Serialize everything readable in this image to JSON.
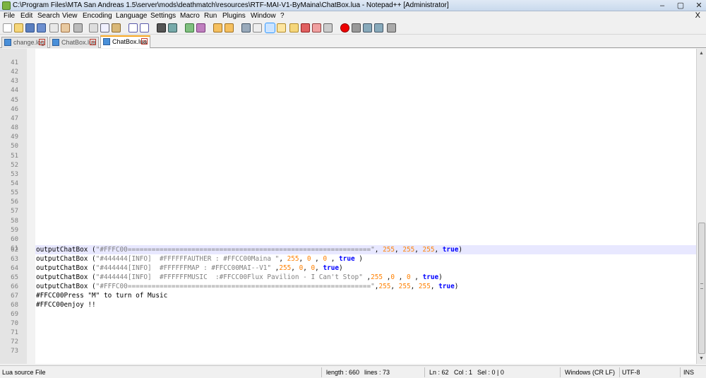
{
  "window": {
    "title": "C:\\Program Files\\MTA San Andreas 1.5\\server\\mods\\deathmatch\\resources\\RTF-MAI-V1-ByMaina\\ChatBox.lua - Notepad++ [Administrator]",
    "controls": [
      "–",
      "▢",
      "✕"
    ]
  },
  "menu": {
    "items": [
      "File",
      "Edit",
      "Search",
      "View",
      "Encoding",
      "Language",
      "Settings",
      "Macro",
      "Run",
      "Plugins",
      "Window",
      "?"
    ],
    "close_label": "X"
  },
  "tabs": [
    {
      "label": "change.log",
      "active": false
    },
    {
      "label": "ChatBox.lua",
      "active": false
    },
    {
      "label": "ChatBox.lua",
      "active": true
    }
  ],
  "editor": {
    "empty_lines": [
      "41",
      "42",
      "43",
      "44",
      "45",
      "46",
      "47",
      "48",
      "49",
      "50",
      "51",
      "52",
      "53",
      "54",
      "55",
      "56",
      "57",
      "58",
      "59",
      "60",
      "61"
    ],
    "code_lines": [
      {
        "num": "62",
        "fn": "outputChatBox",
        "open": " (",
        "str": "\"#FFFC00=============================================================\"",
        "rest": [
          ", ",
          "255",
          ", ",
          "255",
          ", ",
          "255",
          ", "
        ],
        "kw": "true",
        "close": ")"
      },
      {
        "num": "63",
        "fn": "outputChatBox",
        "open": " (",
        "str": "\"#444444[INFO]  #FFFFFFAUTHER : #FFCC00Maina \"",
        "rest": [
          ", ",
          "255",
          ", ",
          "0",
          " , ",
          "0",
          " , "
        ],
        "kw": "true",
        "close": " )"
      },
      {
        "num": "64",
        "fn": "outputChatBox",
        "open": " (",
        "str": "\"#444444[INFO]  #FFFFFFMAP : #FFCC00MAI--V1\"",
        "rest": [
          " ,",
          "255",
          ", ",
          "0",
          ", ",
          "0",
          ", "
        ],
        "kw": "true",
        "close": ")"
      },
      {
        "num": "65",
        "fn": "outputChatBox",
        "open": " (",
        "str": "\"#444444[INFO]  #FFFFFFMUSIC  :#FFCC00Flux Pavilion - I Can't Stop\"",
        "rest": [
          " ,",
          "255",
          " ,",
          "0",
          " , ",
          "0",
          " , "
        ],
        "kw": "true",
        "close": ")"
      },
      {
        "num": "66",
        "fn": "outputChatBox",
        "open": " (",
        "str": "\"#FFFC00=============================================================\"",
        "rest": [
          ",",
          "255",
          ", ",
          "255",
          ", ",
          "255",
          ", "
        ],
        "kw": "true",
        "close": ")"
      }
    ],
    "text_lines": [
      {
        "num": "67",
        "text": "#FFCC00Press \"M\" to turn of Music"
      },
      {
        "num": "68",
        "text": "#FFCC00enjoy !!"
      },
      {
        "num": "69",
        "text": ""
      },
      {
        "num": "70",
        "text": ""
      },
      {
        "num": "71",
        "text": ""
      },
      {
        "num": "72",
        "text": ""
      },
      {
        "num": "73",
        "text": ""
      }
    ],
    "current_line": "62"
  },
  "status": {
    "file_type": "Lua source File",
    "length": "length : 660",
    "lines": "lines : 73",
    "ln": "Ln : 62",
    "col": "Col : 1",
    "sel": "Sel : 0 | 0",
    "eol": "Windows (CR LF)",
    "encoding": "UTF-8",
    "mode": "INS"
  },
  "colors": {
    "keyword": "#0000ff",
    "number": "#ff8000",
    "string": "#808080",
    "current_line_bg": "#e8e8ff",
    "active_tab_accent": "#f5a623"
  }
}
